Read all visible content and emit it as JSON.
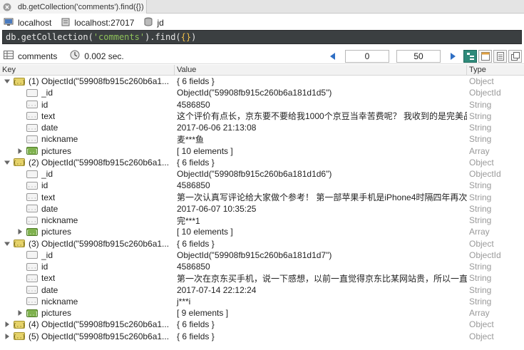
{
  "tab": {
    "title": "db.getCollection('comments').find({})",
    "close_icon": "close-icon"
  },
  "connection": {
    "host": "localhost",
    "server": "localhost:27017",
    "database": "jd"
  },
  "query": {
    "prefix": "db.getCollection(",
    "collection": "'comments'",
    "middle": ").find(",
    "filter": "{}",
    "suffix": ")"
  },
  "result": {
    "collection": "comments",
    "time": "0.002 sec.",
    "skip": "0",
    "limit": "50"
  },
  "columns": {
    "key": "Key",
    "value": "Value",
    "type": "Type"
  },
  "rows": [
    {
      "level": 0,
      "toggle": "open",
      "icon": "object",
      "key": "(1) ObjectId(\"59908fb915c260b6a1...",
      "value": "{ 6 fields }",
      "type": "Object"
    },
    {
      "level": 1,
      "toggle": "none",
      "icon": "objectid",
      "key": "_id",
      "value": "ObjectId(\"59908fb915c260b6a181d1d5\")",
      "type": "ObjectId"
    },
    {
      "level": 1,
      "toggle": "none",
      "icon": "string",
      "key": "id",
      "value": "4586850",
      "type": "String"
    },
    {
      "level": 1,
      "toggle": "none",
      "icon": "string",
      "key": "text",
      "value": "这个评价有点长，京东要不要给我1000个京豆当幸苦费呢？ 我收到的是完美品...",
      "type": "String"
    },
    {
      "level": 1,
      "toggle": "none",
      "icon": "string",
      "key": "date",
      "value": "2017-06-06 21:13:08",
      "type": "String"
    },
    {
      "level": 1,
      "toggle": "none",
      "icon": "string",
      "key": "nickname",
      "value": "麦***鱼",
      "type": "String"
    },
    {
      "level": 1,
      "toggle": "closed",
      "icon": "array",
      "key": "pictures",
      "value": "[ 10 elements ]",
      "type": "Array"
    },
    {
      "level": 0,
      "toggle": "open",
      "icon": "object",
      "key": "(2) ObjectId(\"59908fb915c260b6a1...",
      "value": "{ 6 fields }",
      "type": "Object"
    },
    {
      "level": 1,
      "toggle": "none",
      "icon": "objectid",
      "key": "_id",
      "value": "ObjectId(\"59908fb915c260b6a181d1d6\")",
      "type": "ObjectId"
    },
    {
      "level": 1,
      "toggle": "none",
      "icon": "string",
      "key": "id",
      "value": "4586850",
      "type": "String"
    },
    {
      "level": 1,
      "toggle": "none",
      "icon": "string",
      "key": "text",
      "value": "第一次认真写评论给大家做个参考！ 第一部苹果手机是iPhone4时隔四年再次...",
      "type": "String"
    },
    {
      "level": 1,
      "toggle": "none",
      "icon": "string",
      "key": "date",
      "value": "2017-06-07 10:35:25",
      "type": "String"
    },
    {
      "level": 1,
      "toggle": "none",
      "icon": "string",
      "key": "nickname",
      "value": "完***1",
      "type": "String"
    },
    {
      "level": 1,
      "toggle": "closed",
      "icon": "array",
      "key": "pictures",
      "value": "[ 10 elements ]",
      "type": "Array"
    },
    {
      "level": 0,
      "toggle": "open",
      "icon": "object",
      "key": "(3) ObjectId(\"59908fb915c260b6a1...",
      "value": "{ 6 fields }",
      "type": "Object"
    },
    {
      "level": 1,
      "toggle": "none",
      "icon": "objectid",
      "key": "_id",
      "value": "ObjectId(\"59908fb915c260b6a181d1d7\")",
      "type": "ObjectId"
    },
    {
      "level": 1,
      "toggle": "none",
      "icon": "string",
      "key": "id",
      "value": "4586850",
      "type": "String"
    },
    {
      "level": 1,
      "toggle": "none",
      "icon": "string",
      "key": "text",
      "value": "第一次在京东买手机，说一下感想，以前一直觉得京东比某网站贵，所以一直...",
      "type": "String"
    },
    {
      "level": 1,
      "toggle": "none",
      "icon": "string",
      "key": "date",
      "value": "2017-07-14 22:12:24",
      "type": "String"
    },
    {
      "level": 1,
      "toggle": "none",
      "icon": "string",
      "key": "nickname",
      "value": "j***i",
      "type": "String"
    },
    {
      "level": 1,
      "toggle": "closed",
      "icon": "array",
      "key": "pictures",
      "value": "[ 9 elements ]",
      "type": "Array"
    },
    {
      "level": 0,
      "toggle": "closed",
      "icon": "object",
      "key": "(4) ObjectId(\"59908fb915c260b6a1...",
      "value": "{ 6 fields }",
      "type": "Object"
    },
    {
      "level": 0,
      "toggle": "closed",
      "icon": "object",
      "key": "(5) ObjectId(\"59908fb915c260b6a1...",
      "value": "{ 6 fields }",
      "type": "Object"
    }
  ]
}
